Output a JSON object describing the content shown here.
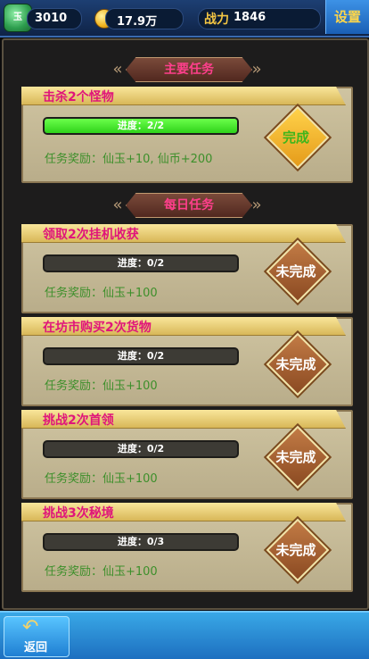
{
  "topbar": {
    "jade_value": "3010",
    "jade_icon_text": "玉",
    "coin_value": "17.9万",
    "power_label": "战力",
    "power_value": "1846",
    "settings_label": "设置"
  },
  "main_section": {
    "title": "主要任务"
  },
  "main_task": {
    "title": "击杀2个怪物",
    "progress_text": "进度：2/2",
    "progress": 1.0,
    "reward": "任务奖励：仙玉+10, 仙币+200",
    "status": "完成"
  },
  "daily_section": {
    "title": "每日任务"
  },
  "daily_tasks": [
    {
      "title": "领取2次挂机收获",
      "progress_text": "进度：0/2",
      "progress": 0,
      "reward": "任务奖励：仙玉+100",
      "status": "未完成"
    },
    {
      "title": "在坊市购买2次货物",
      "progress_text": "进度：0/2",
      "progress": 0,
      "reward": "任务奖励：仙玉+100",
      "status": "未完成"
    },
    {
      "title": "挑战2次首领",
      "progress_text": "进度：0/2",
      "progress": 0,
      "reward": "任务奖励：仙玉+100",
      "status": "未完成"
    },
    {
      "title": "挑战3次秘境",
      "progress_text": "进度：0/3",
      "progress": 0,
      "reward": "任务奖励：仙玉+100",
      "status": "未完成"
    }
  ],
  "bottombar": {
    "back_label": "返回"
  },
  "colors": {
    "accent_pink": "#e0157a",
    "reward_green": "#3d8f2b",
    "done_gold": "#ffd24a"
  },
  "icons": {
    "jade": "jade-icon",
    "coin": "coin-icon",
    "back": "back-arrow-icon"
  }
}
